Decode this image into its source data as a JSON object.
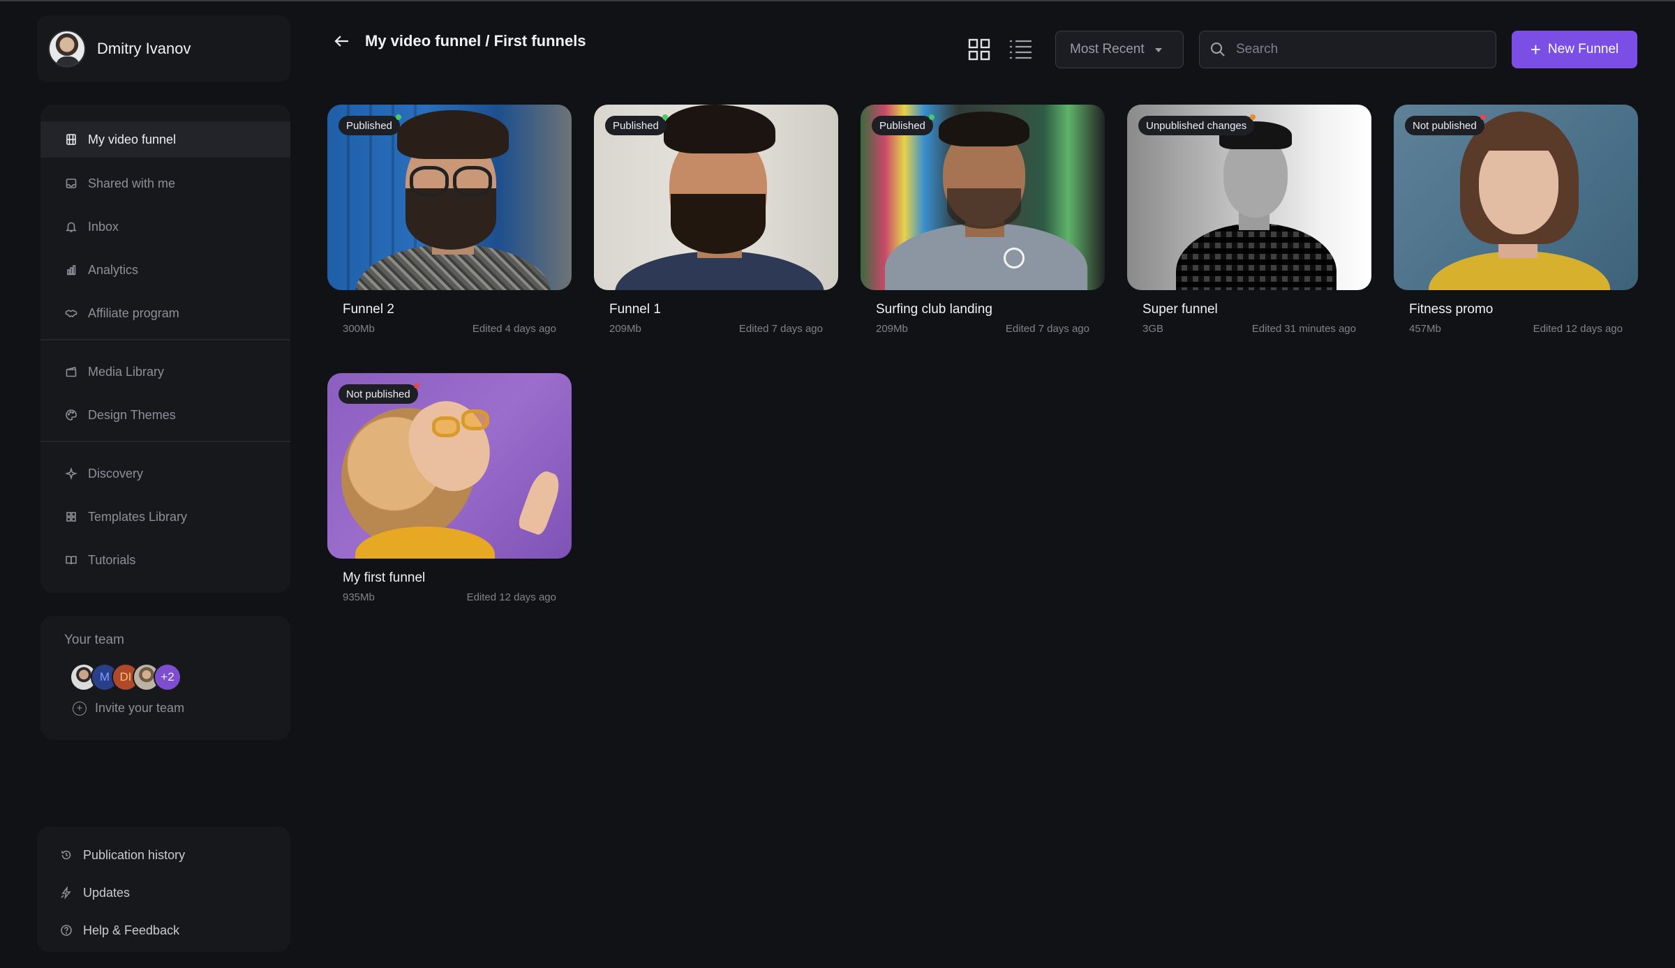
{
  "user": {
    "name": "Dmitry Ivanov"
  },
  "nav": {
    "primary": [
      {
        "label": "My video funnel",
        "icon": "film-icon",
        "active": true
      },
      {
        "label": "Shared with me",
        "icon": "inbox-tray-icon"
      },
      {
        "label": "Inbox",
        "icon": "bell-icon"
      },
      {
        "label": "Analytics",
        "icon": "bar-chart-icon"
      },
      {
        "label": "Affiliate program",
        "icon": "handshake-icon"
      }
    ],
    "secondary": [
      {
        "label": "Media Library",
        "icon": "clapperboard-icon"
      },
      {
        "label": "Design Themes",
        "icon": "palette-icon"
      }
    ],
    "tertiary": [
      {
        "label": "Discovery",
        "icon": "sparkle-icon"
      },
      {
        "label": "Templates Library",
        "icon": "grid-icon"
      },
      {
        "label": "Tutorials",
        "icon": "book-icon"
      }
    ]
  },
  "team": {
    "title": "Your team",
    "members": [
      "",
      "M",
      "DI",
      "",
      "+2"
    ],
    "invite_label": "Invite your team"
  },
  "bottom_nav": [
    {
      "label": "Publication history",
      "icon": "history-icon"
    },
    {
      "label": "Updates",
      "icon": "lightning-icon"
    },
    {
      "label": "Help & Feedback",
      "icon": "help-circle-icon"
    }
  ],
  "header": {
    "title": "My video funnel / First funnels",
    "sort_label": "Most Recent",
    "search_placeholder": "Search",
    "new_button_label": "New Funnel"
  },
  "colors": {
    "accent": "#7b4fe6",
    "published": "#3ecf6a",
    "unpublished_changes": "#f08a24",
    "not_published": "#e5484d"
  },
  "funnels": [
    {
      "title": "Funnel 2",
      "size": "300Mb",
      "edited": "Edited 4 days ago",
      "status": "Published",
      "status_color": "#3ecf6a"
    },
    {
      "title": "Funnel 1",
      "size": "209Mb",
      "edited": "Edited 7 days ago",
      "status": "Published",
      "status_color": "#3ecf6a"
    },
    {
      "title": "Surfing club landing",
      "size": "209Mb",
      "edited": "Edited 7 days ago",
      "status": "Published",
      "status_color": "#3ecf6a"
    },
    {
      "title": "Super funnel",
      "size": "3GB",
      "edited": "Edited 31 minutes ago",
      "status": "Unpublished changes",
      "status_color": "#f08a24"
    },
    {
      "title": "Fitness promo",
      "size": "457Mb",
      "edited": "Edited 12 days ago",
      "status": "Not published",
      "status_color": "#e5484d"
    },
    {
      "title": "My first funnel",
      "size": "935Mb",
      "edited": "Edited 12 days ago",
      "status": "Not published",
      "status_color": "#e5484d"
    }
  ]
}
